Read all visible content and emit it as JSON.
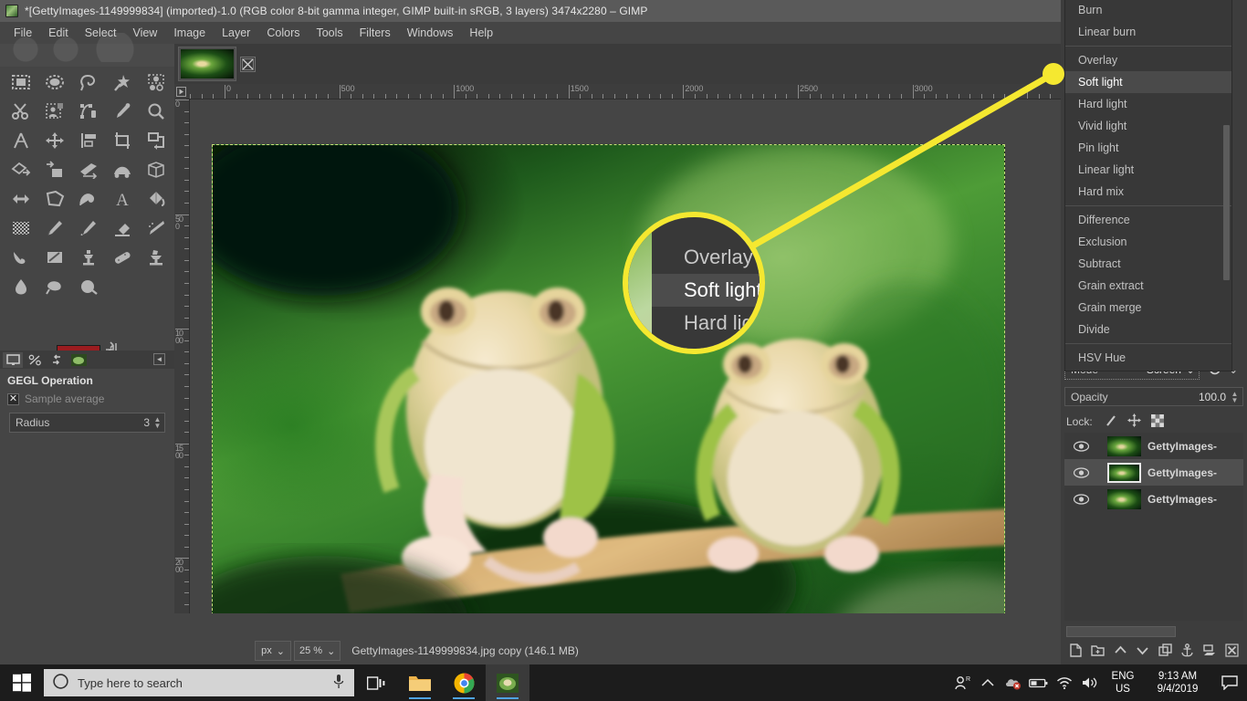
{
  "window": {
    "title": "*[GettyImages-1149999834] (imported)-1.0 (RGB color 8-bit gamma integer, GIMP built-in sRGB, 3 layers) 3474x2280 – GIMP",
    "app_icon": "gimp-wilber-icon"
  },
  "menubar": {
    "items": [
      {
        "label": "File"
      },
      {
        "label": "Edit"
      },
      {
        "label": "Select"
      },
      {
        "label": "View"
      },
      {
        "label": "Image"
      },
      {
        "label": "Layer"
      },
      {
        "label": "Colors"
      },
      {
        "label": "Tools"
      },
      {
        "label": "Filters"
      },
      {
        "label": "Windows"
      },
      {
        "label": "Help"
      }
    ]
  },
  "toolbox": {
    "tools": [
      {
        "name": "rect-select-tool"
      },
      {
        "name": "ellipse-select-tool"
      },
      {
        "name": "free-select-tool"
      },
      {
        "name": "fuzzy-select-tool"
      },
      {
        "name": "select-by-color-tool"
      },
      {
        "name": "scissors-select-tool"
      },
      {
        "name": "foreground-select-tool"
      },
      {
        "name": "paths-tool"
      },
      {
        "name": "color-picker-tool"
      },
      {
        "name": "zoom-tool"
      },
      {
        "name": "measure-tool"
      },
      {
        "name": "move-tool"
      },
      {
        "name": "alignment-tool"
      },
      {
        "name": "crop-tool"
      },
      {
        "name": "rotate-tool"
      },
      {
        "name": "scale-tool"
      },
      {
        "name": "shear-tool"
      },
      {
        "name": "perspective-tool"
      },
      {
        "name": "unified-transform-tool"
      },
      {
        "name": "handle-transform-tool"
      },
      {
        "name": "flip-tool"
      },
      {
        "name": "cage-transform-tool"
      },
      {
        "name": "warp-transform-tool"
      },
      {
        "name": "text-tool"
      },
      {
        "name": "bucket-fill-tool"
      },
      {
        "name": "gradient-tool"
      },
      {
        "name": "pencil-tool"
      },
      {
        "name": "paintbrush-tool"
      },
      {
        "name": "eraser-tool"
      },
      {
        "name": "airbrush-tool"
      },
      {
        "name": "ink-tool"
      },
      {
        "name": "mypaint-brush-tool"
      },
      {
        "name": "clone-tool"
      },
      {
        "name": "heal-tool"
      },
      {
        "name": "perspective-clone-tool"
      },
      {
        "name": "blur-sharpen-tool"
      },
      {
        "name": "smudge-tool"
      },
      {
        "name": "dodge-burn-tool"
      }
    ],
    "foreground_color": "#9b1c20",
    "background_color": "#d8d8d8"
  },
  "tool_options": {
    "dock_tabs": [
      "tool-options-tab",
      "device-status-tab",
      "undo-history-tab",
      "images-tab"
    ],
    "title": "GEGL Operation",
    "sample_average": {
      "label": "Sample average",
      "checked": true
    },
    "radius": {
      "label": "Radius",
      "value": "3"
    }
  },
  "image_window": {
    "tab_thumbnail": "document-thumbnail",
    "close_label": "⌧",
    "h_ruler_labels": [
      "0",
      "500",
      "1000",
      "1500",
      "2000",
      "2500",
      "3000"
    ],
    "v_ruler_labels": [
      "0",
      "500",
      "1000",
      "1500",
      "2000"
    ]
  },
  "statusbar": {
    "unit": "px",
    "zoom": "25 %",
    "message": "GettyImages-1149999834.jpg copy (146.1 MB)"
  },
  "layers_panel": {
    "mode": {
      "label": "Mode",
      "value": "Screen"
    },
    "opacity": {
      "label": "Opacity",
      "value": "100.0"
    },
    "lock": {
      "label": "Lock:",
      "icons": [
        "lock-pixels-icon",
        "lock-position-icon",
        "lock-alpha-icon"
      ]
    },
    "layers": [
      {
        "name": "GettyImages-",
        "visible": true,
        "selected": false
      },
      {
        "name": "GettyImages-",
        "visible": true,
        "selected": true
      },
      {
        "name": "GettyImages-",
        "visible": true,
        "selected": false
      }
    ],
    "footer_buttons": [
      "new-layer-icon",
      "new-layer-group-icon",
      "raise-layer-icon",
      "lower-layer-icon",
      "duplicate-layer-icon",
      "anchor-layer-icon",
      "merge-down-icon",
      "delete-layer-icon"
    ]
  },
  "blend_menu": {
    "items": [
      {
        "label": "Burn",
        "selected": false,
        "separator_after": false
      },
      {
        "label": "Linear burn",
        "selected": false,
        "separator_after": true
      },
      {
        "label": "Overlay",
        "selected": false,
        "separator_after": false
      },
      {
        "label": "Soft light",
        "selected": true,
        "separator_after": false
      },
      {
        "label": "Hard light",
        "selected": false,
        "separator_after": false
      },
      {
        "label": "Vivid light",
        "selected": false,
        "separator_after": false
      },
      {
        "label": "Pin light",
        "selected": false,
        "separator_after": false
      },
      {
        "label": "Linear light",
        "selected": false,
        "separator_after": false
      },
      {
        "label": "Hard mix",
        "selected": false,
        "separator_after": true
      },
      {
        "label": "Difference",
        "selected": false,
        "separator_after": false
      },
      {
        "label": "Exclusion",
        "selected": false,
        "separator_after": false
      },
      {
        "label": "Subtract",
        "selected": false,
        "separator_after": false
      },
      {
        "label": "Grain extract",
        "selected": false,
        "separator_after": false
      },
      {
        "label": "Grain merge",
        "selected": false,
        "separator_after": false
      },
      {
        "label": "Divide",
        "selected": false,
        "separator_after": true
      },
      {
        "label": "HSV Hue",
        "selected": false,
        "separator_after": false
      }
    ]
  },
  "callout": {
    "color": "#f5e830",
    "magnified_items": [
      {
        "label": "Overlay",
        "selected": false
      },
      {
        "label": "Soft light",
        "selected": true
      },
      {
        "label": "Hard light",
        "selected": false
      }
    ]
  },
  "taskbar": {
    "start_icon": "windows-start-icon",
    "search_placeholder": "Type here to search",
    "search_icon": "cortana-circle-icon",
    "mic_icon": "microphone-icon",
    "task_view_icon": "task-view-icon",
    "apps": [
      {
        "name": "file-explorer-icon",
        "active": false
      },
      {
        "name": "chrome-icon",
        "active": false
      },
      {
        "name": "gimp-icon",
        "active": true
      }
    ],
    "tray": [
      {
        "name": "people-icon"
      },
      {
        "name": "show-hidden-icons-chevron"
      },
      {
        "name": "onedrive-error-icon"
      },
      {
        "name": "battery-icon"
      },
      {
        "name": "wifi-icon"
      },
      {
        "name": "volume-icon"
      }
    ],
    "language_line1": "ENG",
    "language_line2": "US",
    "time": "9:13 AM",
    "date": "9/4/2019",
    "action_center_icon": "notification-icon"
  }
}
